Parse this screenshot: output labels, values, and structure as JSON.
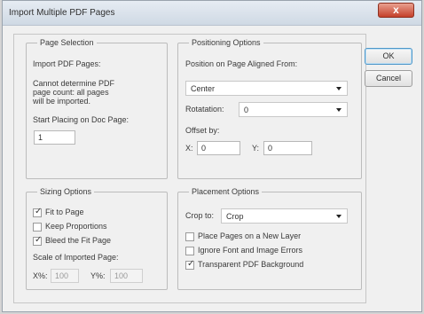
{
  "window": {
    "title": "Import Multiple PDF Pages",
    "close_glyph": "x"
  },
  "page_selection": {
    "legend": "Page Selection",
    "import_label": "Import PDF Pages:",
    "message_line1": "Cannot determine PDF",
    "message_line2": "page count: all pages",
    "message_line3": "will be imported.",
    "start_label": "Start Placing on Doc Page:",
    "start_value": "1"
  },
  "positioning": {
    "legend": "Positioning Options",
    "aligned_label": "Position on Page Aligned From:",
    "aligned_value": "Center",
    "rotation_label": "Rotatation:",
    "rotation_value": "0",
    "offset_label": "Offset by:",
    "x_label": "X:",
    "x_value": "0",
    "y_label": "Y:",
    "y_value": "0"
  },
  "sizing": {
    "legend": "Sizing Options",
    "fit_label": "Fit to Page",
    "fit_checked": true,
    "keep_label": "Keep Proportions",
    "keep_checked": false,
    "bleed_label": "Bleed the Fit Page",
    "bleed_checked": true,
    "scale_label": "Scale of Imported Page:",
    "xpct_label": "X%:",
    "xpct_value": "100",
    "ypct_label": "Y%:",
    "ypct_value": "100"
  },
  "placement": {
    "legend": "Placement Options",
    "crop_label": "Crop to:",
    "crop_value": "Crop",
    "new_layer_label": "Place Pages on a New Layer",
    "new_layer_checked": false,
    "ignore_label": "Ignore Font and Image Errors",
    "ignore_checked": false,
    "transparent_label": "Transparent PDF Background",
    "transparent_checked": true
  },
  "buttons": {
    "ok": "OK",
    "cancel": "Cancel"
  },
  "colors": {
    "title_bar": "#cfd9e4",
    "close_button": "#c4402a",
    "default_button_border": "#4e97c9"
  }
}
